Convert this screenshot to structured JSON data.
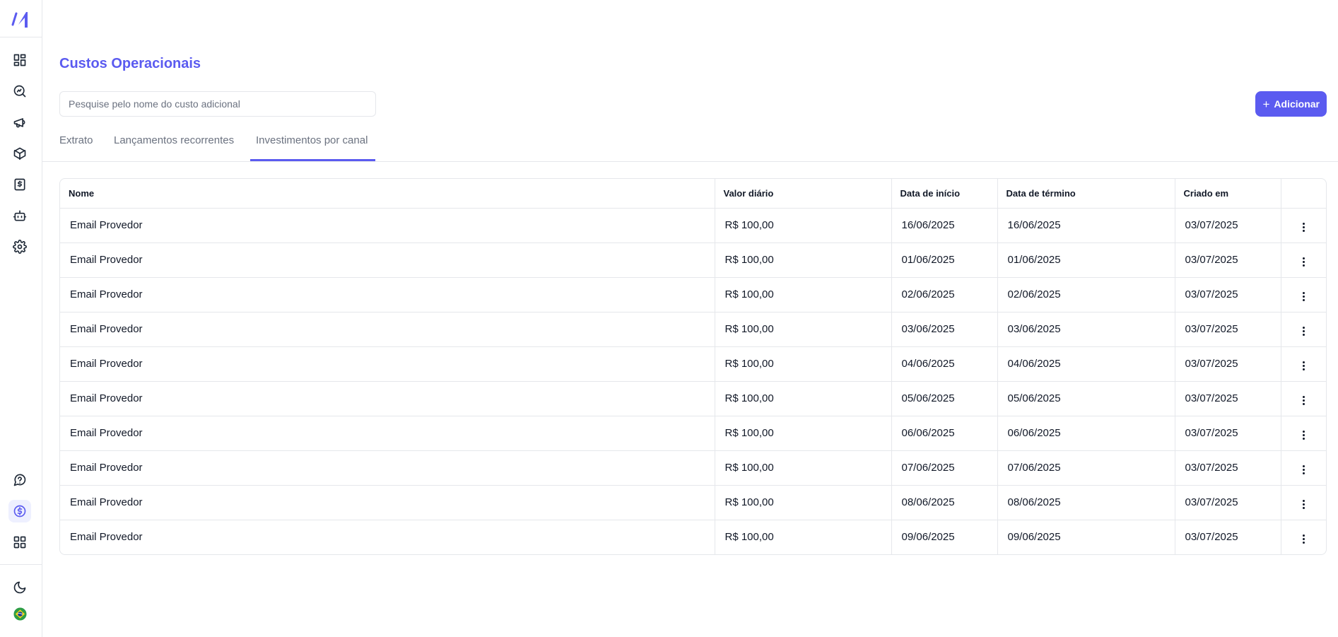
{
  "page": {
    "title": "Custos Operacionais",
    "search_placeholder": "Pesquise pelo nome do custo adicional",
    "add_label": "Adicionar"
  },
  "tabs": [
    {
      "label": "Extrato",
      "active": false
    },
    {
      "label": "Lançamentos recorrentes",
      "active": false
    },
    {
      "label": "Investimentos por canal",
      "active": true
    }
  ],
  "table": {
    "headers": [
      "Nome",
      "Valor diário",
      "Data de início",
      "Data de término",
      "Criado em",
      ""
    ],
    "rows": [
      [
        "Email Provedor",
        "R$ 100,00",
        "16/06/2025",
        "16/06/2025",
        "03/07/2025"
      ],
      [
        "Email Provedor",
        "R$ 100,00",
        "01/06/2025",
        "01/06/2025",
        "03/07/2025"
      ],
      [
        "Email Provedor",
        "R$ 100,00",
        "02/06/2025",
        "02/06/2025",
        "03/07/2025"
      ],
      [
        "Email Provedor",
        "R$ 100,00",
        "03/06/2025",
        "03/06/2025",
        "03/07/2025"
      ],
      [
        "Email Provedor",
        "R$ 100,00",
        "04/06/2025",
        "04/06/2025",
        "03/07/2025"
      ],
      [
        "Email Provedor",
        "R$ 100,00",
        "05/06/2025",
        "05/06/2025",
        "03/07/2025"
      ],
      [
        "Email Provedor",
        "R$ 100,00",
        "06/06/2025",
        "06/06/2025",
        "03/07/2025"
      ],
      [
        "Email Provedor",
        "R$ 100,00",
        "07/06/2025",
        "07/06/2025",
        "03/07/2025"
      ],
      [
        "Email Provedor",
        "R$ 100,00",
        "08/06/2025",
        "08/06/2025",
        "03/07/2025"
      ],
      [
        "Email Provedor",
        "R$ 100,00",
        "09/06/2025",
        "09/06/2025",
        "03/07/2025"
      ]
    ]
  },
  "sidebar": {
    "top_icons": [
      "dashboard-icon",
      "search-analytics-icon",
      "megaphone-icon",
      "package-icon",
      "dollar-receipt-icon",
      "bot-icon",
      "settings-icon"
    ],
    "bottom_icons": [
      "help-chat-icon",
      "dollar-circle-icon",
      "apps-grid-icon",
      "moon-icon",
      "brazil-flag-icon"
    ],
    "active_icon": "dollar-circle-icon"
  },
  "colors": {
    "accent": "#5b5bf0",
    "border": "#e5e7eb",
    "muted_text": "#6b7280"
  }
}
